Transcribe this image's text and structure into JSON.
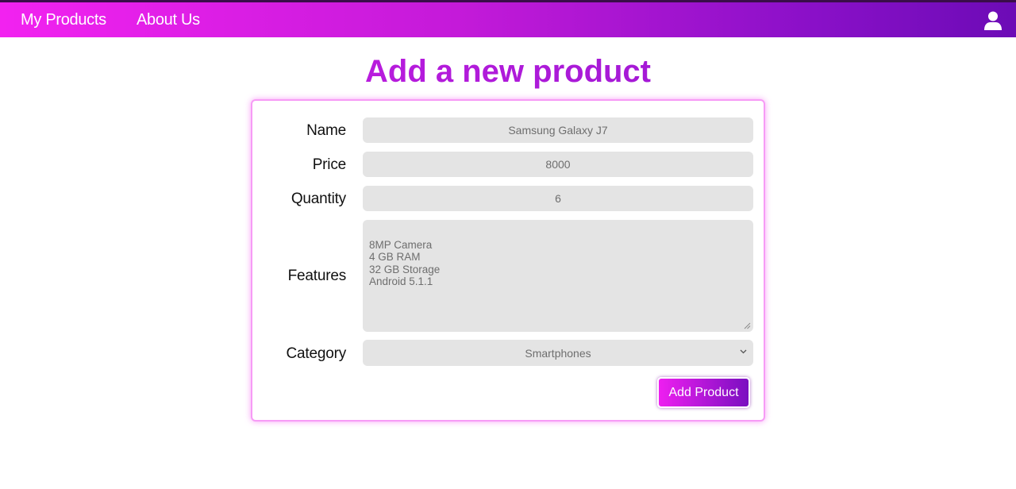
{
  "nav": {
    "links": [
      "My Products",
      "About Us"
    ],
    "user_icon": "user-icon"
  },
  "page": {
    "title": "Add a new product"
  },
  "form": {
    "name": {
      "label": "Name",
      "value": "Samsung Galaxy J7"
    },
    "price": {
      "label": "Price",
      "value": "8000"
    },
    "quantity": {
      "label": "Quantity",
      "value": "6"
    },
    "features": {
      "label": "Features",
      "value": "8MP Camera\n4 GB RAM\n32 GB Storage\nAndroid 5.1.1"
    },
    "category": {
      "label": "Category",
      "value": "Smartphones",
      "icon": "chevron-down-icon"
    },
    "submit_label": "Add Product"
  },
  "colors": {
    "nav_gradient_start": "#f222f0",
    "nav_gradient_end": "#6c0bb6",
    "card_border": "#f79bf6",
    "field_bg": "#e4e4e4"
  }
}
